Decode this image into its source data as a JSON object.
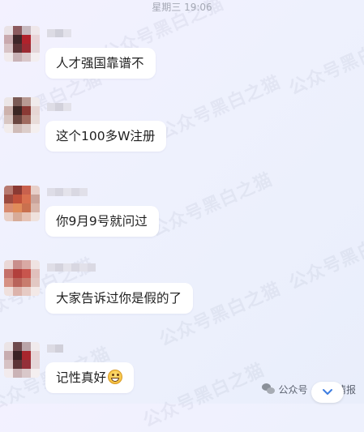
{
  "header": {
    "timestamp": "星期三 19:06"
  },
  "watermark": "公众号黑白之猫",
  "messages": [
    {
      "text": "人才强国靠谱不",
      "emoji": ""
    },
    {
      "text": "这个100多W注册",
      "emoji": ""
    },
    {
      "text": "你9月9号就问过",
      "emoji": ""
    },
    {
      "text": "大家告诉过你是假的了",
      "emoji": ""
    },
    {
      "text": "记性真好",
      "emoji": "grinning-face"
    }
  ],
  "footer": {
    "source": "公众号 · 小话情报",
    "icon": "wechat-icon"
  },
  "scroll_down": {
    "icon": "chevron-down-icon"
  }
}
